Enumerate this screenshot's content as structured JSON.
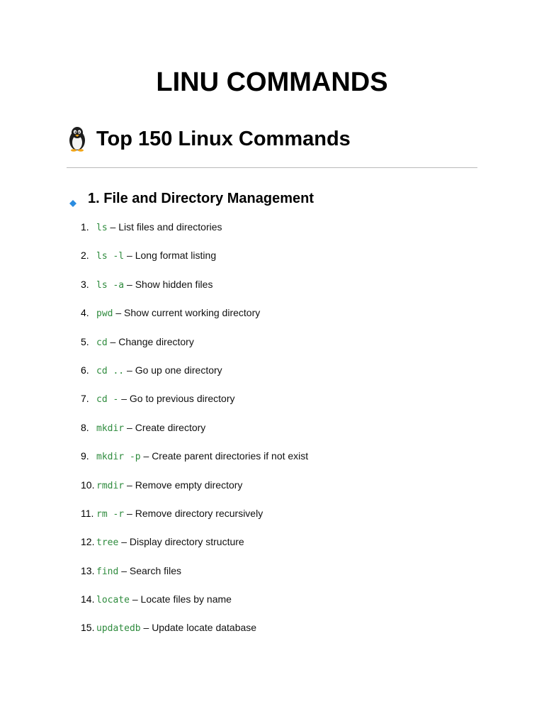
{
  "document": {
    "title": "LINU COMMANDS",
    "subtitle": "Top 150 Linux Commands",
    "subtitle_icon": "penguin-icon",
    "section": {
      "heading": "1. File and Directory Management",
      "bullet_icon": "blue-diamond-icon",
      "bullet_color": "#2a8ce0",
      "commands": [
        {
          "number": "1.",
          "code": "ls",
          "description": "– List files and directories"
        },
        {
          "number": "2.",
          "code": "ls -l",
          "description": "– Long format listing"
        },
        {
          "number": "3.",
          "code": "ls -a",
          "description": "– Show hidden files"
        },
        {
          "number": "4.",
          "code": "pwd",
          "description": "– Show current working directory"
        },
        {
          "number": "5.",
          "code": "cd",
          "description": "– Change directory"
        },
        {
          "number": "6.",
          "code": "cd ..",
          "description": "– Go up one directory"
        },
        {
          "number": "7.",
          "code": "cd -",
          "description": "– Go to previous directory"
        },
        {
          "number": "8.",
          "code": "mkdir",
          "description": "– Create directory"
        },
        {
          "number": "9.",
          "code": "mkdir -p",
          "description": "– Create parent directories if not exist"
        },
        {
          "number": "10.",
          "code": "rmdir",
          "description": "– Remove empty directory"
        },
        {
          "number": "11.",
          "code": "rm -r",
          "description": "– Remove directory recursively"
        },
        {
          "number": "12.",
          "code": "tree",
          "description": "– Display directory structure"
        },
        {
          "number": "13.",
          "code": "find",
          "description": "– Search files"
        },
        {
          "number": "14.",
          "code": "locate",
          "description": "– Locate files by name"
        },
        {
          "number": "15.",
          "code": "updatedb",
          "description": "– Update locate database"
        }
      ]
    }
  },
  "colors": {
    "code_text": "#2e8b3d",
    "divider": "#b9b9b9",
    "body_text": "#111111"
  }
}
